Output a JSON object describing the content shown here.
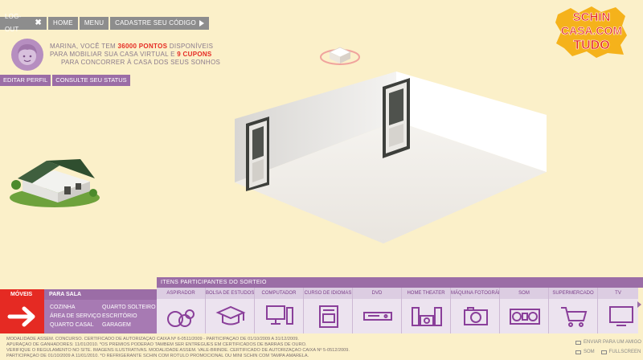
{
  "topnav": {
    "logout": "LOG-OUT",
    "home": "HOME",
    "menu": "MENU",
    "register_code": "CADASTRE SEU CÓDIGO"
  },
  "user": {
    "line1_pre": "MARINA, VOCÊ TEM",
    "points": "36000 PONTOS",
    "line1_post": "DISPONÍVEIS",
    "line2_pre": "PARA MOBILIAR SUA CASA VIRTUAL E",
    "coupons": "9 CUPONS",
    "line3": "PARA CONCORRER À CASA DOS SEUS SONHOS",
    "edit_profile": "EDITAR PERFIL",
    "check_status": "CONSULTE SEU STATUS"
  },
  "logo": {
    "line1": "SCHIN",
    "line2": "CASA.COM",
    "line3": "TUDO"
  },
  "categories": {
    "moveis": "MÓVEIS",
    "para_sala": "PARA SALA",
    "rooms": [
      "COZINHA",
      "QUARTO SOLTEIRO",
      "ÁREA DE SERVIÇO",
      "ESCRITÓRIO",
      "QUARTO CASAL",
      "GARAGEM"
    ]
  },
  "items_header": "ITENS PARTICIPANTES DO SORTEIO",
  "items": [
    {
      "label": "ASPIRADOR",
      "icon": "vacuum-icon"
    },
    {
      "label": "BOLSA DE ESTUDOS",
      "icon": "graduation-cap-icon"
    },
    {
      "label": "COMPUTADOR",
      "icon": "computer-icon"
    },
    {
      "label": "CURSO DE IDIOMAS",
      "icon": "book-icon"
    },
    {
      "label": "DVD",
      "icon": "dvd-player-icon"
    },
    {
      "label": "HOME THEATER",
      "icon": "home-theater-icon"
    },
    {
      "label": "MÁQUINA FOTOGRÁFICA",
      "icon": "camera-icon"
    },
    {
      "label": "SOM",
      "icon": "stereo-icon"
    },
    {
      "label": "SUPERMERCADO",
      "icon": "shopping-cart-icon"
    },
    {
      "label": "TV",
      "icon": "tv-icon"
    }
  ],
  "legal": [
    "MODALIDADE ASSEM. CONCURSO. CERTIFICADO DE AUTORIZAÇÃO CAIXA Nº 6-0511/2009 - PARTICIPAÇÃO DE 01/10/2009 A 31/12/2009.",
    "APURAÇÃO DE GANHADORES: 11/01/2010. *OS PRÊMIOS PODERÃO TAMBÉM SER ENTREGUES EM CERTIFICADOS DE BARRAS DE OURO.",
    "VERIFIQUE O REGULAMENTO NO SITE. IMAGENS ILUSTRATIVAS. MODALIDADE ASSEM. VALE-BRINDE. CERTIFICADO DE AUTORIZAÇÃO CAIXA Nº 5-0512/2009.",
    "PARTICIPAÇÃO DE 01/10/2009 A 11/01/2010. *O REFRIGERANTE SCHIN COM RÓTULO PROMOCIONAL OU MINI SCHIN COM TAMPA AMARELA."
  ],
  "footer": {
    "send_friend": "ENVIAR PARA UM AMIGO",
    "sound": "SOM",
    "fullscreen": "FULLSCREEN"
  },
  "colors": {
    "background": "#fbf0c9",
    "red": "#e52a23",
    "purple": "#9b6da6",
    "gray": "#8d8d8d"
  }
}
